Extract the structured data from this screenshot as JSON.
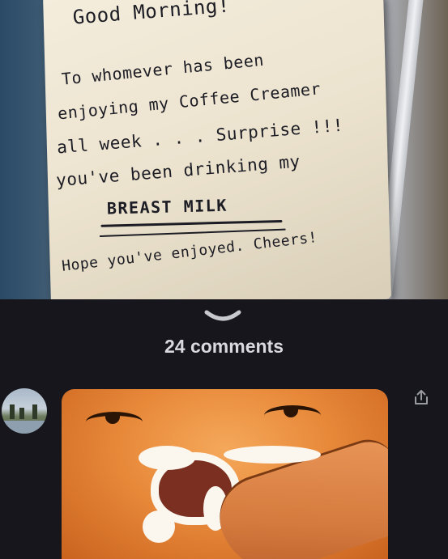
{
  "note": {
    "lines": [
      "Good Morning!",
      "To whomever has been",
      "enjoying my Coffee Creamer",
      "all week . . . Surprise !!!",
      "you've been drinking my",
      "BREAST MILK",
      "Hope you've enjoyed. Cheers!"
    ]
  },
  "comments": {
    "title": "24 comments"
  },
  "icons": {
    "collapse": "chevron-down-icon",
    "share": "share-icon",
    "avatar": "user-avatar"
  },
  "colors": {
    "sheet_background": "#16161c",
    "title_text": "#d9d9de",
    "note_paper": "#f0e8d5"
  }
}
